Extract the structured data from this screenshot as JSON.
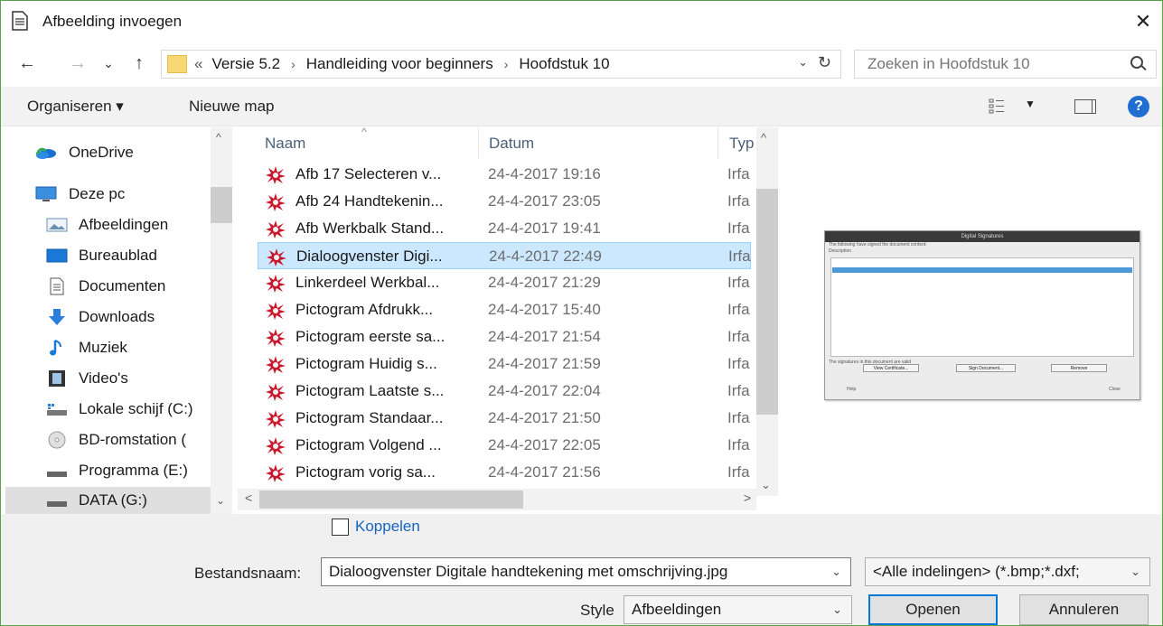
{
  "window": {
    "title": "Afbeelding invoegen",
    "close_glyph": "✕"
  },
  "nav": {
    "back": "←",
    "forward": "→",
    "recent": "⌄",
    "up": "↑",
    "breadcrumb_prefix": "«",
    "crumbs": [
      "Versie 5.2",
      "Handleiding voor beginners",
      "Hoofdstuk 10"
    ],
    "crumb_sep": "›",
    "dropdown": "⌄",
    "refresh": "↻"
  },
  "search": {
    "placeholder": "Zoeken in Hoofdstuk 10"
  },
  "toolbar": {
    "organize": "Organiseren ▾",
    "new_folder": "Nieuwe map",
    "view_dd": "▼",
    "help": "?"
  },
  "sidebar": {
    "items": [
      {
        "label": "OneDrive",
        "icon": "onedrive-icon"
      },
      {
        "label": "Deze pc",
        "icon": "computer-icon"
      },
      {
        "label": "Afbeeldingen",
        "icon": "pictures-icon"
      },
      {
        "label": "Bureaublad",
        "icon": "desktop-icon"
      },
      {
        "label": "Documenten",
        "icon": "documents-icon"
      },
      {
        "label": "Downloads",
        "icon": "downloads-icon"
      },
      {
        "label": "Muziek",
        "icon": "music-icon"
      },
      {
        "label": "Video's",
        "icon": "videos-icon"
      },
      {
        "label": "Lokale schijf (C:)",
        "icon": "drive-icon"
      },
      {
        "label": "BD-romstation (",
        "icon": "disc-icon"
      },
      {
        "label": "Programma (E:)",
        "icon": "drive-icon"
      },
      {
        "label": "DATA (G:)",
        "icon": "drive-icon"
      }
    ],
    "scroll_up": "^",
    "scroll_down": "⌄"
  },
  "filelist": {
    "columns": {
      "name": "Naam",
      "date": "Datum",
      "type": "Typ",
      "sort_caret": "^"
    },
    "rows": [
      {
        "name": "Afb 17 Selecteren v...",
        "date": "24-4-2017 19:16",
        "type": "Irfa"
      },
      {
        "name": "Afb 24 Handtekenin...",
        "date": "24-4-2017 23:05",
        "type": "Irfa"
      },
      {
        "name": "Afb Werkbalk Stand...",
        "date": "24-4-2017 19:41",
        "type": "Irfa"
      },
      {
        "name": "Dialoogvenster Digi...",
        "date": "24-4-2017 22:49",
        "type": "Irfa",
        "selected": true
      },
      {
        "name": "Linkerdeel Werkbal...",
        "date": "24-4-2017 21:29",
        "type": "Irfa"
      },
      {
        "name": "Pictogram Afdrukk...",
        "date": "24-4-2017 15:40",
        "type": "Irfa"
      },
      {
        "name": "Pictogram eerste sa...",
        "date": "24-4-2017 21:54",
        "type": "Irfa"
      },
      {
        "name": "Pictogram Huidig s...",
        "date": "24-4-2017 21:59",
        "type": "Irfa"
      },
      {
        "name": "Pictogram Laatste s...",
        "date": "24-4-2017 22:04",
        "type": "Irfa"
      },
      {
        "name": "Pictogram Standaar...",
        "date": "24-4-2017 21:50",
        "type": "Irfa"
      },
      {
        "name": "Pictogram Volgend ...",
        "date": "24-4-2017 22:05",
        "type": "Irfa"
      },
      {
        "name": "Pictogram vorig sa...",
        "date": "24-4-2017 21:56",
        "type": "Irfa"
      }
    ],
    "scroll_up": "^",
    "scroll_down": "⌄",
    "scroll_left": "<",
    "scroll_right": ">"
  },
  "preview": {
    "title": "Digital Signatures",
    "line1": "The following have signed the document content:",
    "line2": "Description",
    "status": "The signatures in this document are valid",
    "buttons": [
      "View Certificate...",
      "Sign Document...",
      "Remove"
    ],
    "help": "Help",
    "close": "Close"
  },
  "bottom": {
    "link_label": "Koppelen",
    "filename_label": "Bestandsnaam:",
    "filename_value": "Dialoogvenster Digitale handtekening met omschrijving.jpg",
    "filter_value": "<Alle indelingen> (*.bmp;*.dxf;",
    "style_label": "Style",
    "style_value": "Afbeeldingen",
    "open": "Openen",
    "cancel": "Annuleren",
    "combo_arrow": "⌄"
  },
  "colors": {
    "accent": "#0078d7",
    "selection": "#cce8ff",
    "link": "#1565c0"
  }
}
